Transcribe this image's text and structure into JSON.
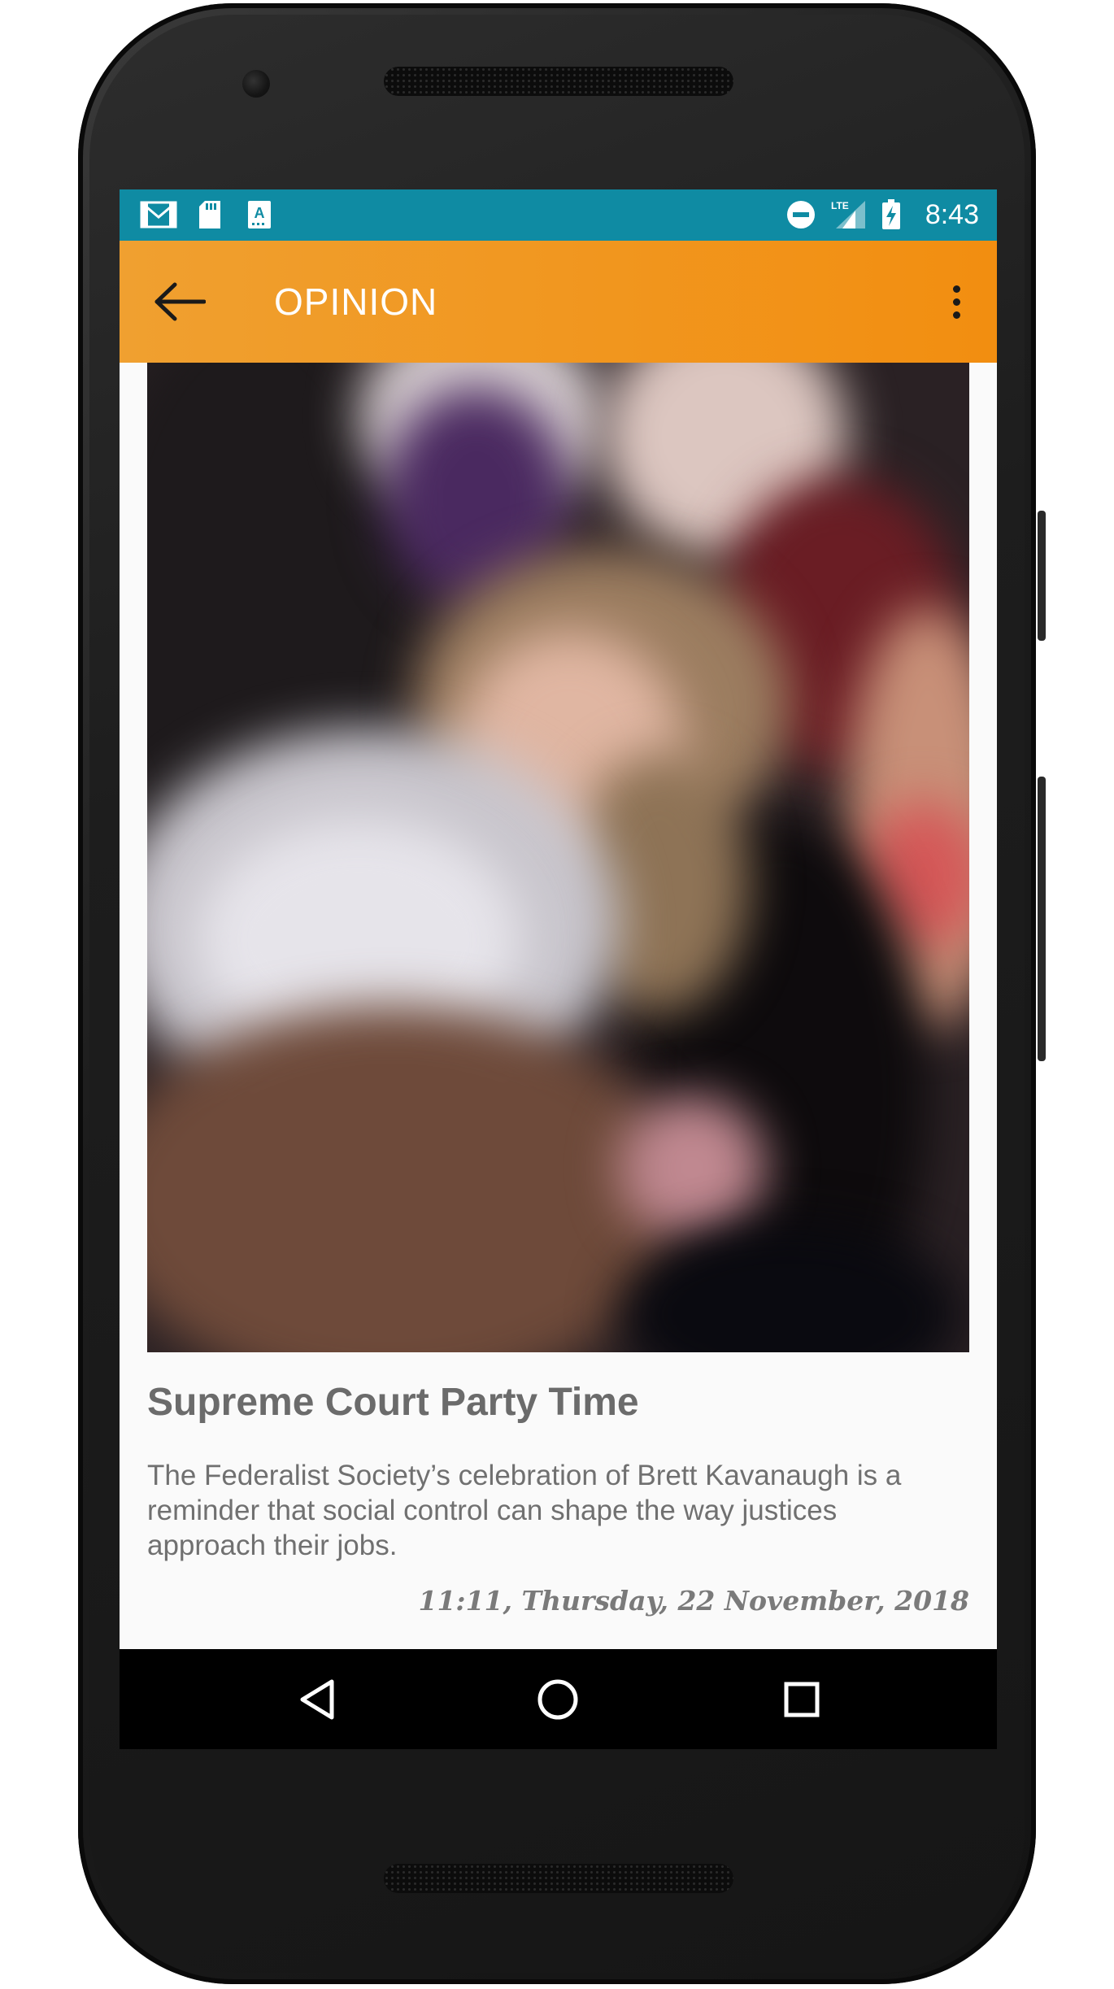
{
  "status_bar": {
    "time": "8:43",
    "left_icons": [
      "gmail-icon",
      "sd-card-icon",
      "text-a-icon"
    ],
    "right_icons": [
      "do-not-disturb-icon",
      "lte-signal-icon",
      "battery-charging-icon"
    ],
    "network_label": "LTE",
    "color": "#0f8ba3"
  },
  "toolbar": {
    "title": "OPINION",
    "back_icon": "arrow-back-icon",
    "menu_icon": "more-vert-icon",
    "color": "#f28e10"
  },
  "article": {
    "image_description_icon": "photo-image",
    "title": "Supreme Court Party Time",
    "summary": "The Federalist Society’s celebration of Brett Kavanaugh is a reminder that social control can shape the way justices approach their jobs.",
    "date": "11:11, Thursday, 22 November, 2018"
  },
  "nav_bar": {
    "back_icon": "triangle-back-icon",
    "home_icon": "circle-home-icon",
    "recents_icon": "square-recents-icon"
  }
}
